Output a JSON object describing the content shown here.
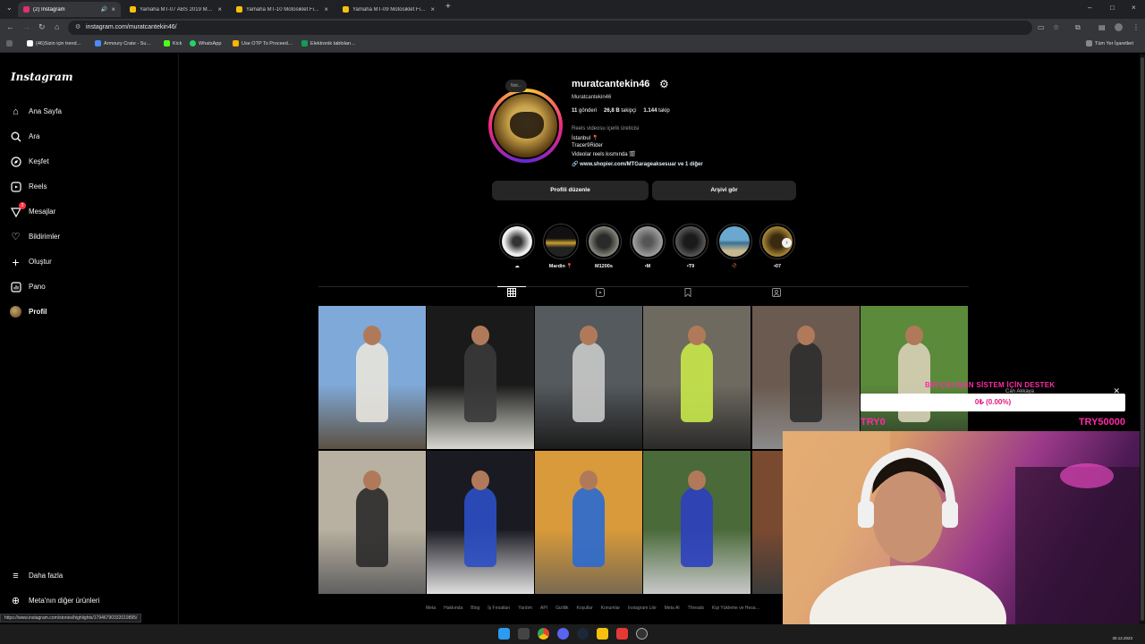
{
  "browser": {
    "tabs": [
      {
        "label": "(2) Instagram",
        "active": true,
        "favicon_color": "#e1306c"
      },
      {
        "label": "Yamaha MT-07 ABS 2019 Mod…",
        "active": false,
        "favicon_color": "#f4c20d"
      },
      {
        "label": "Yamaha MT-10 Motosiklet Fiya…",
        "active": false,
        "favicon_color": "#f4c20d"
      },
      {
        "label": "Yamaha MT-09 Motosiklet Fiya…",
        "active": false,
        "favicon_color": "#f4c20d"
      }
    ],
    "new_tab_icon": "plus-icon",
    "url": "instagram.com/muratcantekin46/",
    "bookmarks": [
      {
        "label": "(46)Sizin için trend…",
        "color": "#ffffff"
      },
      {
        "label": "Armoury Crate - Su…",
        "color": "#4b8bff"
      },
      {
        "label": "Kick",
        "color": "#53fc18"
      },
      {
        "label": "WhatsApp",
        "color": "#25d366"
      },
      {
        "label": "Use OTP To Proceed…",
        "color": "#ffb300"
      },
      {
        "label": "Elektronik tabloları…",
        "color": "#0f9d58"
      }
    ],
    "all_bookmarks": "Tüm Yer İşaretleri"
  },
  "sidebar": {
    "logo": "Instagram",
    "items": [
      {
        "label": "Ana Sayfa",
        "icon": "home-icon"
      },
      {
        "label": "Ara",
        "icon": "search-icon"
      },
      {
        "label": "Keşfet",
        "icon": "compass-icon"
      },
      {
        "label": "Reels",
        "icon": "reels-icon"
      },
      {
        "label": "Mesajlar",
        "icon": "messenger-icon",
        "badge": "2"
      },
      {
        "label": "Bildirimler",
        "icon": "heart-icon"
      },
      {
        "label": "Oluştur",
        "icon": "plus-icon"
      },
      {
        "label": "Pano",
        "icon": "dashboard-icon"
      },
      {
        "label": "Profil",
        "icon": "avatar"
      }
    ],
    "more": "Daha fazla",
    "meta_products": "Meta'nın diğer ürünleri"
  },
  "profile": {
    "note": "Not...",
    "username": "muratcantekin46",
    "full_name": "Muratcantekin46",
    "stats": {
      "posts_count": "11",
      "posts_label": "gönderi",
      "followers_count": "26,8 B",
      "followers_label": "takipçi",
      "following_count": "1.144",
      "following_label": "takip"
    },
    "category": "Reels videosu içerik üreticisi",
    "bio": [
      "İstanbul 📍",
      "Tracer9Rider",
      "Videolar reels kısmında 🎬"
    ],
    "link": "www.shopier.com/MTGarageaksesuar ve 1 diğer",
    "edit_button": "Profili düzenle",
    "archive_button": "Arşivi gör"
  },
  "highlights": [
    {
      "label": "☁",
      "color": "#e8e8e8"
    },
    {
      "label": "Mardin 📍",
      "color": "#3a3220"
    },
    {
      "label": "M1200s",
      "color": "#6a6a6a"
    },
    {
      "label": "•M",
      "color": "#8a8a8a"
    },
    {
      "label": "•T9",
      "color": "#4a4a4a"
    },
    {
      "label": "🥀",
      "color": "#4d8fb0"
    },
    {
      "label": "•07",
      "color": "#9b7a30"
    }
  ],
  "profile_tabs": [
    {
      "icon": "grid-icon",
      "active": true
    },
    {
      "icon": "reels-tab-icon",
      "active": false
    },
    {
      "icon": "bookmark-icon",
      "active": false
    },
    {
      "icon": "tagged-icon",
      "active": false
    }
  ],
  "posts": [
    {
      "colors": [
        "#7fa9d8",
        "#e8e4dc",
        "#5c5142"
      ]
    },
    {
      "colors": [
        "#1a1a1a",
        "#3a3a3a",
        "#d8d8d0"
      ]
    },
    {
      "colors": [
        "#555a5e",
        "#c9c9c9",
        "#1c1c1c"
      ]
    },
    {
      "colors": [
        "#6e6a60",
        "#c8e84a",
        "#2a2a2a"
      ]
    },
    {
      "colors": [
        "#6a5a50",
        "#2d2d2d",
        "#8b8b8b"
      ]
    },
    {
      "colors": [
        "#5b8a3a",
        "#d8d0b8",
        "#2a3a2a"
      ]
    },
    {
      "colors": [
        "#b8b0a0",
        "#2a2a2a",
        "#606060"
      ]
    },
    {
      "colors": [
        "#1a1a22",
        "#2c4fc4",
        "#e0e0e0"
      ]
    },
    {
      "colors": [
        "#d89a3a",
        "#2a6ad0",
        "#7a6a50"
      ]
    },
    {
      "colors": [
        "#4a6a3a",
        "#2c40c0",
        "#c8c8c8"
      ]
    },
    {
      "colors": [
        "#7a4a30",
        "#c02828",
        "#3a3a3a"
      ]
    }
  ],
  "footer": [
    "Meta",
    "Hakkında",
    "Blog",
    "İş Fırsatları",
    "Yardım",
    "API",
    "Gizlilik",
    "Koşullar",
    "Konumlar",
    "Instagram Lite",
    "Meta AI",
    "Threads",
    "Kişi Yükleme ve Hesa…"
  ],
  "status_url": "https://www.instagram.com/stories/highlights/17946790332019895/",
  "overlay": {
    "title": "BİR ÇALIŞAN SİSTEM İÇİN DESTEK",
    "subtitle": "Can Akkaya",
    "progress_text": "0₺ (0.00%)",
    "progress": 0.0,
    "min": "TRY0",
    "max": "TRY50000"
  },
  "taskbar": {
    "apps": [
      {
        "icon": "windows-icon",
        "color": "#2d9bf0"
      },
      {
        "icon": "search-icon",
        "color": "#444"
      },
      {
        "icon": "chrome-icon",
        "color": "#e94235"
      },
      {
        "icon": "discord-icon",
        "color": "#5865f2"
      },
      {
        "icon": "steam-icon",
        "color": "#1b2838"
      },
      {
        "icon": "bolt-icon",
        "color": "#f4c20d"
      },
      {
        "icon": "record-icon",
        "color": "#e53935"
      },
      {
        "icon": "obs-icon",
        "color": "#333"
      }
    ],
    "date": "30.12.2023"
  }
}
